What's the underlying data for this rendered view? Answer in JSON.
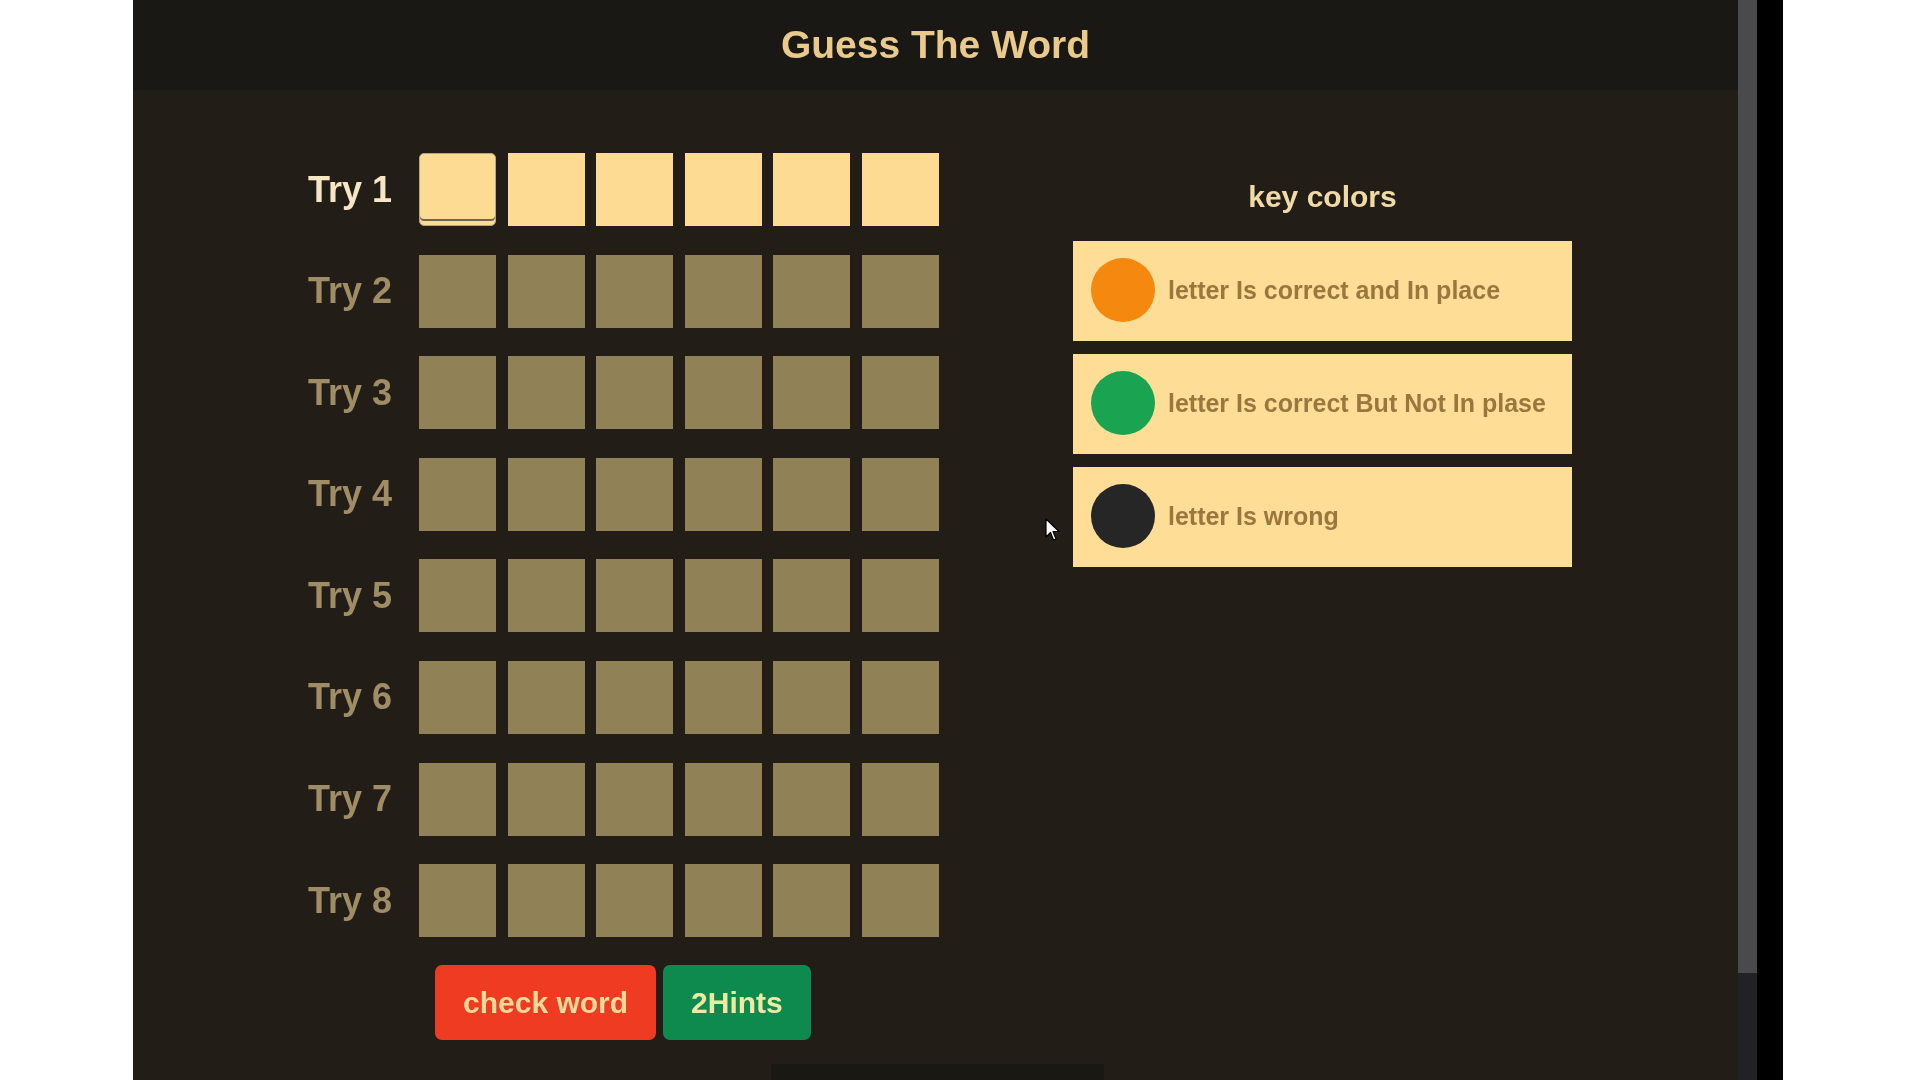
{
  "header": {
    "title": "Guess The Word"
  },
  "tries": [
    {
      "label": "Try 1",
      "disabled": false,
      "cells": [
        {
          "focused": true
        },
        {
          "focused": false
        },
        {
          "focused": false
        },
        {
          "focused": false
        },
        {
          "focused": false
        },
        {
          "focused": false
        }
      ]
    },
    {
      "label": "Try 2",
      "disabled": true,
      "cells": [
        {
          "focused": false
        },
        {
          "focused": false
        },
        {
          "focused": false
        },
        {
          "focused": false
        },
        {
          "focused": false
        },
        {
          "focused": false
        }
      ]
    },
    {
      "label": "Try 3",
      "disabled": true,
      "cells": [
        {
          "focused": false
        },
        {
          "focused": false
        },
        {
          "focused": false
        },
        {
          "focused": false
        },
        {
          "focused": false
        },
        {
          "focused": false
        }
      ]
    },
    {
      "label": "Try 4",
      "disabled": true,
      "cells": [
        {
          "focused": false
        },
        {
          "focused": false
        },
        {
          "focused": false
        },
        {
          "focused": false
        },
        {
          "focused": false
        },
        {
          "focused": false
        }
      ]
    },
    {
      "label": "Try 5",
      "disabled": true,
      "cells": [
        {
          "focused": false
        },
        {
          "focused": false
        },
        {
          "focused": false
        },
        {
          "focused": false
        },
        {
          "focused": false
        },
        {
          "focused": false
        }
      ]
    },
    {
      "label": "Try 6",
      "disabled": true,
      "cells": [
        {
          "focused": false
        },
        {
          "focused": false
        },
        {
          "focused": false
        },
        {
          "focused": false
        },
        {
          "focused": false
        },
        {
          "focused": false
        }
      ]
    },
    {
      "label": "Try 7",
      "disabled": true,
      "cells": [
        {
          "focused": false
        },
        {
          "focused": false
        },
        {
          "focused": false
        },
        {
          "focused": false
        },
        {
          "focused": false
        },
        {
          "focused": false
        }
      ]
    },
    {
      "label": "Try 8",
      "disabled": true,
      "cells": [
        {
          "focused": false
        },
        {
          "focused": false
        },
        {
          "focused": false
        },
        {
          "focused": false
        },
        {
          "focused": false
        },
        {
          "focused": false
        }
      ]
    }
  ],
  "actions": [
    {
      "kind": "check",
      "label": "check word"
    },
    {
      "kind": "hint",
      "label": "2Hints"
    }
  ],
  "key_colors": {
    "title": "key colors",
    "items": [
      {
        "text": "letter Is correct and In place",
        "color": "#f5880f"
      },
      {
        "text": "letter Is correct But Not In plase",
        "color": "#1aa350"
      },
      {
        "text": "letter Is wrong",
        "color": "#262626"
      }
    ]
  }
}
